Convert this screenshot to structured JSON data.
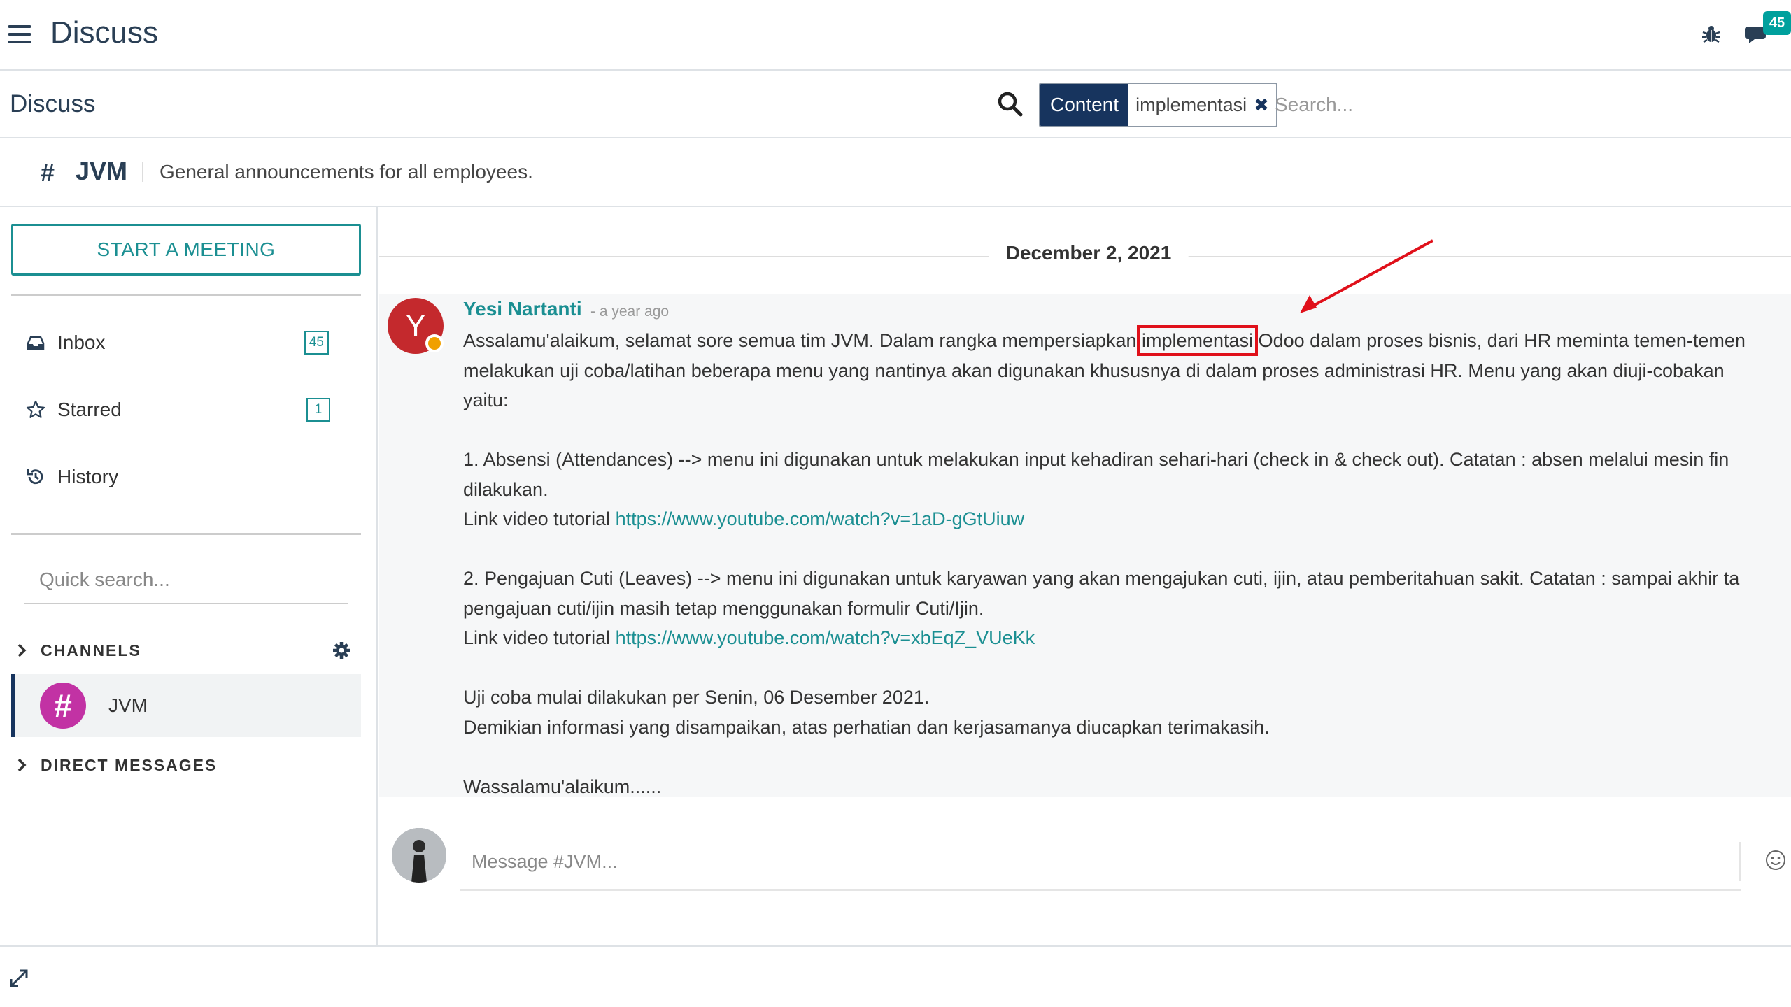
{
  "topbar": {
    "app_title": "Discuss",
    "notification_count": "45"
  },
  "control_panel": {
    "breadcrumb": "Discuss",
    "facet": {
      "label": "Content",
      "value": "implementasi"
    },
    "search_placeholder": "Search..."
  },
  "channel_header": {
    "hash": "#",
    "name": "JVM",
    "description": "General announcements for all employees."
  },
  "sidebar": {
    "start_meeting": "START A MEETING",
    "mailboxes": [
      {
        "label": "Inbox",
        "count": "45",
        "icon": "inbox-icon"
      },
      {
        "label": "Starred",
        "count": "1",
        "icon": "star-icon"
      },
      {
        "label": "History",
        "icon": "history-icon"
      }
    ],
    "quick_search_placeholder": "Quick search...",
    "channels_label": "CHANNELS",
    "channels": [
      {
        "avatar": "#",
        "name": "JVM"
      }
    ],
    "direct_messages_label": "DIRECT MESSAGES"
  },
  "thread": {
    "date_separator": "December 2, 2021",
    "message": {
      "author_initial": "Y",
      "author": "Yesi Nartanti",
      "date": "- a year ago",
      "line1_before": "Assalamu'alaikum, selamat sore semua tim JVM. Dalam rangka mempersiapkan ",
      "line1_highlight": "implementasi",
      "line1_after": " Odoo dalam proses bisnis, dari HR meminta temen-temen",
      "line2": "melakukan uji coba/latihan beberapa menu yang nantinya akan digunakan khususnya di dalam proses administrasi HR. Menu yang akan diuji-cobakan ",
      "line3": "yaitu:",
      "item1_line1": "1. Absensi (Attendances) --> menu ini digunakan untuk melakukan input kehadiran sehari-hari (check in & check out). Catatan : absen melalui mesin fin",
      "item1_line2": "dilakukan.",
      "item1_link_prefix": "Link video tutorial ",
      "item1_link": "https://www.youtube.com/watch?v=1aD-gGtUiuw",
      "item2_line1": "2. Pengajuan Cuti (Leaves) --> menu ini digunakan untuk karyawan yang akan mengajukan cuti, ijin, atau pemberitahuan sakit. Catatan : sampai akhir ta",
      "item2_line2": "pengajuan cuti/ijin masih tetap menggunakan formulir Cuti/Ijin.",
      "item2_link_prefix": "Link video tutorial ",
      "item2_link": "https://www.youtube.com/watch?v=xbEqZ_VUeKk",
      "trial_line": "Uji coba mulai dilakukan per Senin, 06 Desember 2021.",
      "closing_line": "Demikian informasi yang disampaikan, atas perhatian dan kerjasamanya diucapkan terimakasih.",
      "signoff": "Wassalamu'alaikum......"
    }
  },
  "composer": {
    "placeholder": "Message #JVM..."
  },
  "colors": {
    "primary": "#17345e",
    "accent": "#1b8f92",
    "highlight": "#e0101a",
    "channel_avatar": "#c232a4",
    "author_avatar": "#c4292d"
  }
}
